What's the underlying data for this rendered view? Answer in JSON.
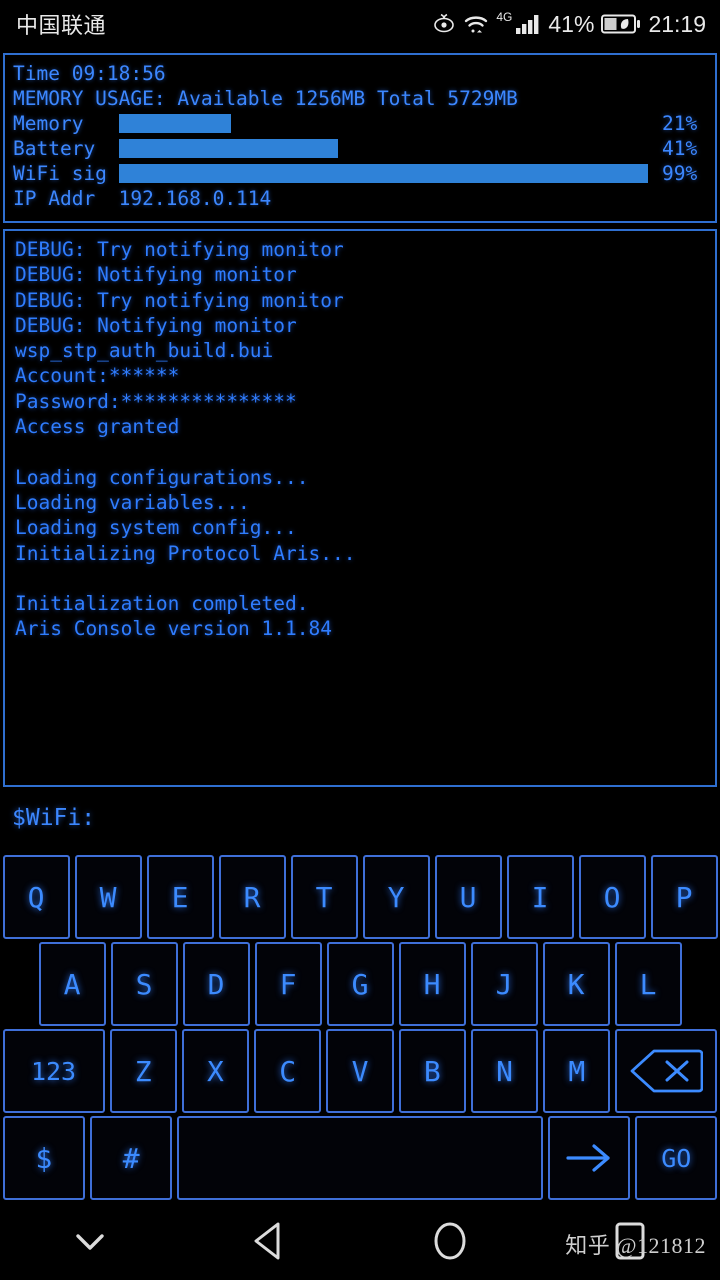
{
  "statusbar": {
    "carrier": "中国联通",
    "icons": [
      "eye-comfort-icon",
      "wifi-icon",
      "cellular-signal-icon",
      "battery-saver-icon"
    ],
    "network_generation": "4G",
    "battery_percent": "41%",
    "clock": "21:19"
  },
  "system_panel": {
    "time_line": "Time 09:18:56",
    "memory_usage_line": "MEMORY USAGE: Available 1256MB Total 5729MB",
    "meters": [
      {
        "label": "Memory",
        "percent": "21%",
        "value": 21
      },
      {
        "label": "Battery",
        "percent": "41%",
        "value": 41
      },
      {
        "label": "WiFi sig",
        "percent": "99%",
        "value": 99
      }
    ],
    "ip_line": "IP Addr  192.168.0.114",
    "bar_color": "#2f82d8",
    "text_color": "#3c87ff",
    "border_color": "#2f6fd0"
  },
  "console": {
    "lines": [
      "DEBUG: Try notifying monitor",
      "DEBUG: Notifying monitor",
      "DEBUG: Try notifying monitor",
      "DEBUG: Notifying monitor",
      "wsp_stp_auth_build.bui",
      "Account:******",
      "Password:***************",
      "Access granted",
      "",
      "Loading configurations...",
      "Loading variables...",
      "Loading system config...",
      "Initializing Protocol Aris...",
      "",
      "Initialization completed.",
      "Aris Console version 1.1.84"
    ],
    "text_color": "#2f7dff"
  },
  "prompt": {
    "text": "$WiFi:"
  },
  "keyboard": {
    "row1": [
      "Q",
      "W",
      "E",
      "R",
      "T",
      "Y",
      "U",
      "I",
      "O",
      "P"
    ],
    "row2": [
      "A",
      "S",
      "D",
      "F",
      "G",
      "H",
      "J",
      "K",
      "L"
    ],
    "row3": [
      "123",
      "Z",
      "X",
      "C",
      "V",
      "B",
      "N",
      "M"
    ],
    "backspace_label": "backspace-icon",
    "row4": [
      "$",
      "#"
    ],
    "space_label": "",
    "arrow_label": "arrow-right-icon",
    "go_label": "GO",
    "key_border_color": "#3f6fd8",
    "key_text_color": "#3c8bff"
  },
  "navbar": {
    "buttons": [
      "hide-keyboard-icon",
      "back-icon",
      "home-icon",
      "recents-icon"
    ],
    "watermark": "知乎 @121812"
  }
}
